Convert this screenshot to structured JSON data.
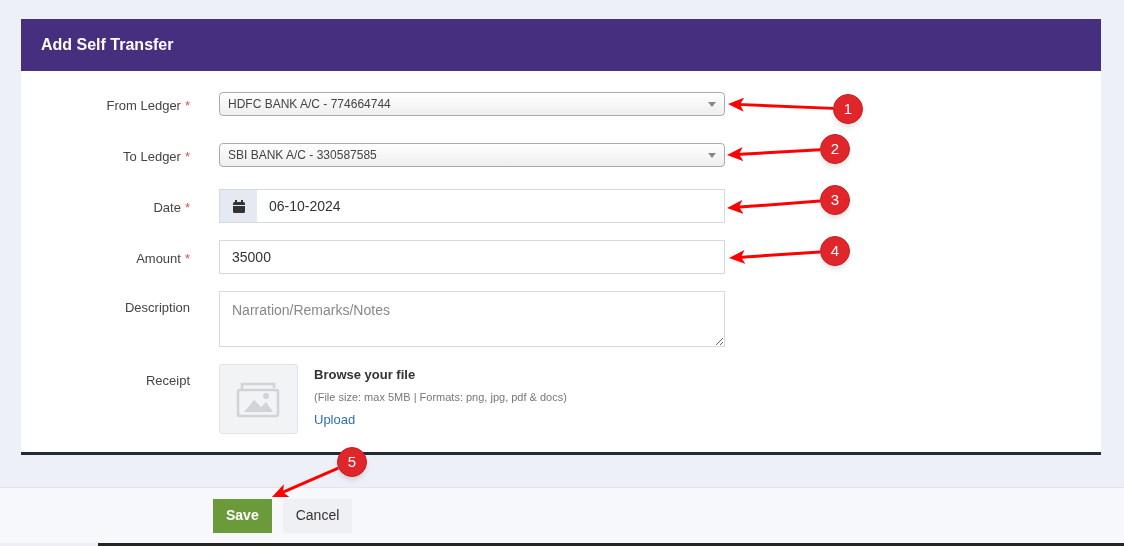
{
  "card": {
    "title": "Add Self Transfer"
  },
  "required_mark": "*",
  "fields": [
    {
      "kind": "select",
      "label": "From Ledger",
      "required": true,
      "value": "HDFC BANK A/C - 774664744"
    },
    {
      "kind": "select",
      "label": "To Ledger",
      "required": true,
      "value": "SBI BANK A/C - 330587585"
    },
    {
      "kind": "date",
      "label": "Date",
      "required": true,
      "value": "06-10-2024"
    },
    {
      "kind": "text",
      "label": "Amount",
      "required": true,
      "value": "35000"
    },
    {
      "kind": "textarea",
      "label": "Description",
      "required": false,
      "placeholder": "Narration/Remarks/Notes"
    },
    {
      "kind": "file",
      "label": "Receipt",
      "required": false,
      "title": "Browse your file",
      "hint": "(File size: max 5MB | Formats: png, jpg, pdf & docs)",
      "link": "Upload"
    }
  ],
  "buttons": [
    {
      "label": "Save",
      "kind": "primary"
    },
    {
      "label": "Cancel",
      "kind": "secondary"
    }
  ],
  "annotations": [
    "1",
    "2",
    "3",
    "4",
    "5"
  ]
}
